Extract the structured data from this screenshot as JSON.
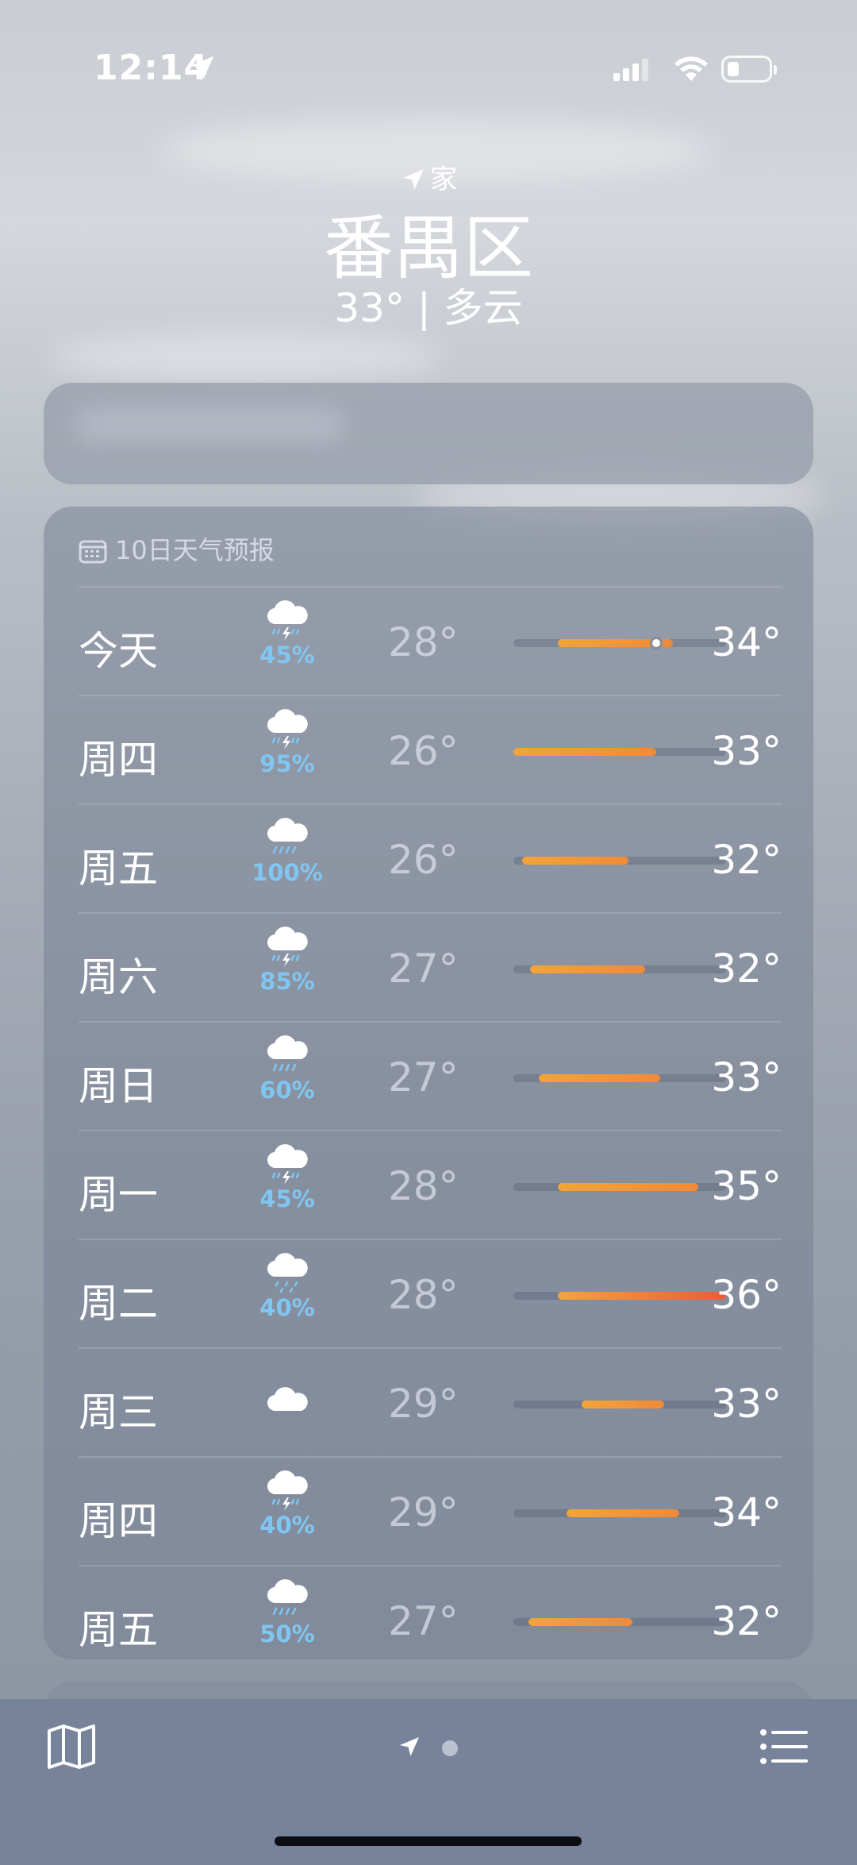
{
  "status_bar": {
    "time": "12:14"
  },
  "header": {
    "location_label": "家",
    "city": "番禺区",
    "summary": "33° | 多云"
  },
  "forecast": {
    "title": "10日天气预报",
    "days": [
      {
        "day": "今天",
        "icon": "thunderstorm-icon",
        "precip": "45%",
        "low": "28°",
        "high": "34°",
        "bar_start": 0.21,
        "bar_end": 0.75,
        "current": 0.67
      },
      {
        "day": "周四",
        "icon": "thunderstorm-icon",
        "precip": "95%",
        "low": "26°",
        "high": "33°",
        "bar_start": 0.0,
        "bar_end": 0.67
      },
      {
        "day": "周五",
        "icon": "rain-icon",
        "precip": "100%",
        "low": "26°",
        "high": "32°",
        "bar_start": 0.04,
        "bar_end": 0.54
      },
      {
        "day": "周六",
        "icon": "thunderstorm-icon",
        "precip": "85%",
        "low": "27°",
        "high": "32°",
        "bar_start": 0.08,
        "bar_end": 0.62
      },
      {
        "day": "周日",
        "icon": "rain-icon",
        "precip": "60%",
        "low": "27°",
        "high": "33°",
        "bar_start": 0.12,
        "bar_end": 0.69
      },
      {
        "day": "周一",
        "icon": "thunderstorm-icon",
        "precip": "45%",
        "low": "28°",
        "high": "35°",
        "bar_start": 0.21,
        "bar_end": 0.87
      },
      {
        "day": "周二",
        "icon": "drizzle-icon",
        "precip": "40%",
        "low": "28°",
        "high": "36°",
        "bar_start": 0.21,
        "bar_end": 1.0
      },
      {
        "day": "周三",
        "icon": "cloud-icon",
        "precip": "",
        "low": "29°",
        "high": "33°",
        "bar_start": 0.32,
        "bar_end": 0.71
      },
      {
        "day": "周四",
        "icon": "thunderstorm-icon",
        "precip": "40%",
        "low": "29°",
        "high": "34°",
        "bar_start": 0.25,
        "bar_end": 0.78
      },
      {
        "day": "周五",
        "icon": "rain-icon",
        "precip": "50%",
        "low": "27°",
        "high": "32°",
        "bar_start": 0.07,
        "bar_end": 0.56
      }
    ]
  },
  "colors": {
    "precip_text": "#7fc6f2",
    "bar_cool": "#f2a43a",
    "bar_warm": "#ee5a3a"
  },
  "tab_bar": {
    "left_icon": "map-icon",
    "center_icons": [
      "location-arrow-icon",
      "page-dot"
    ],
    "right_icon": "list-icon"
  }
}
